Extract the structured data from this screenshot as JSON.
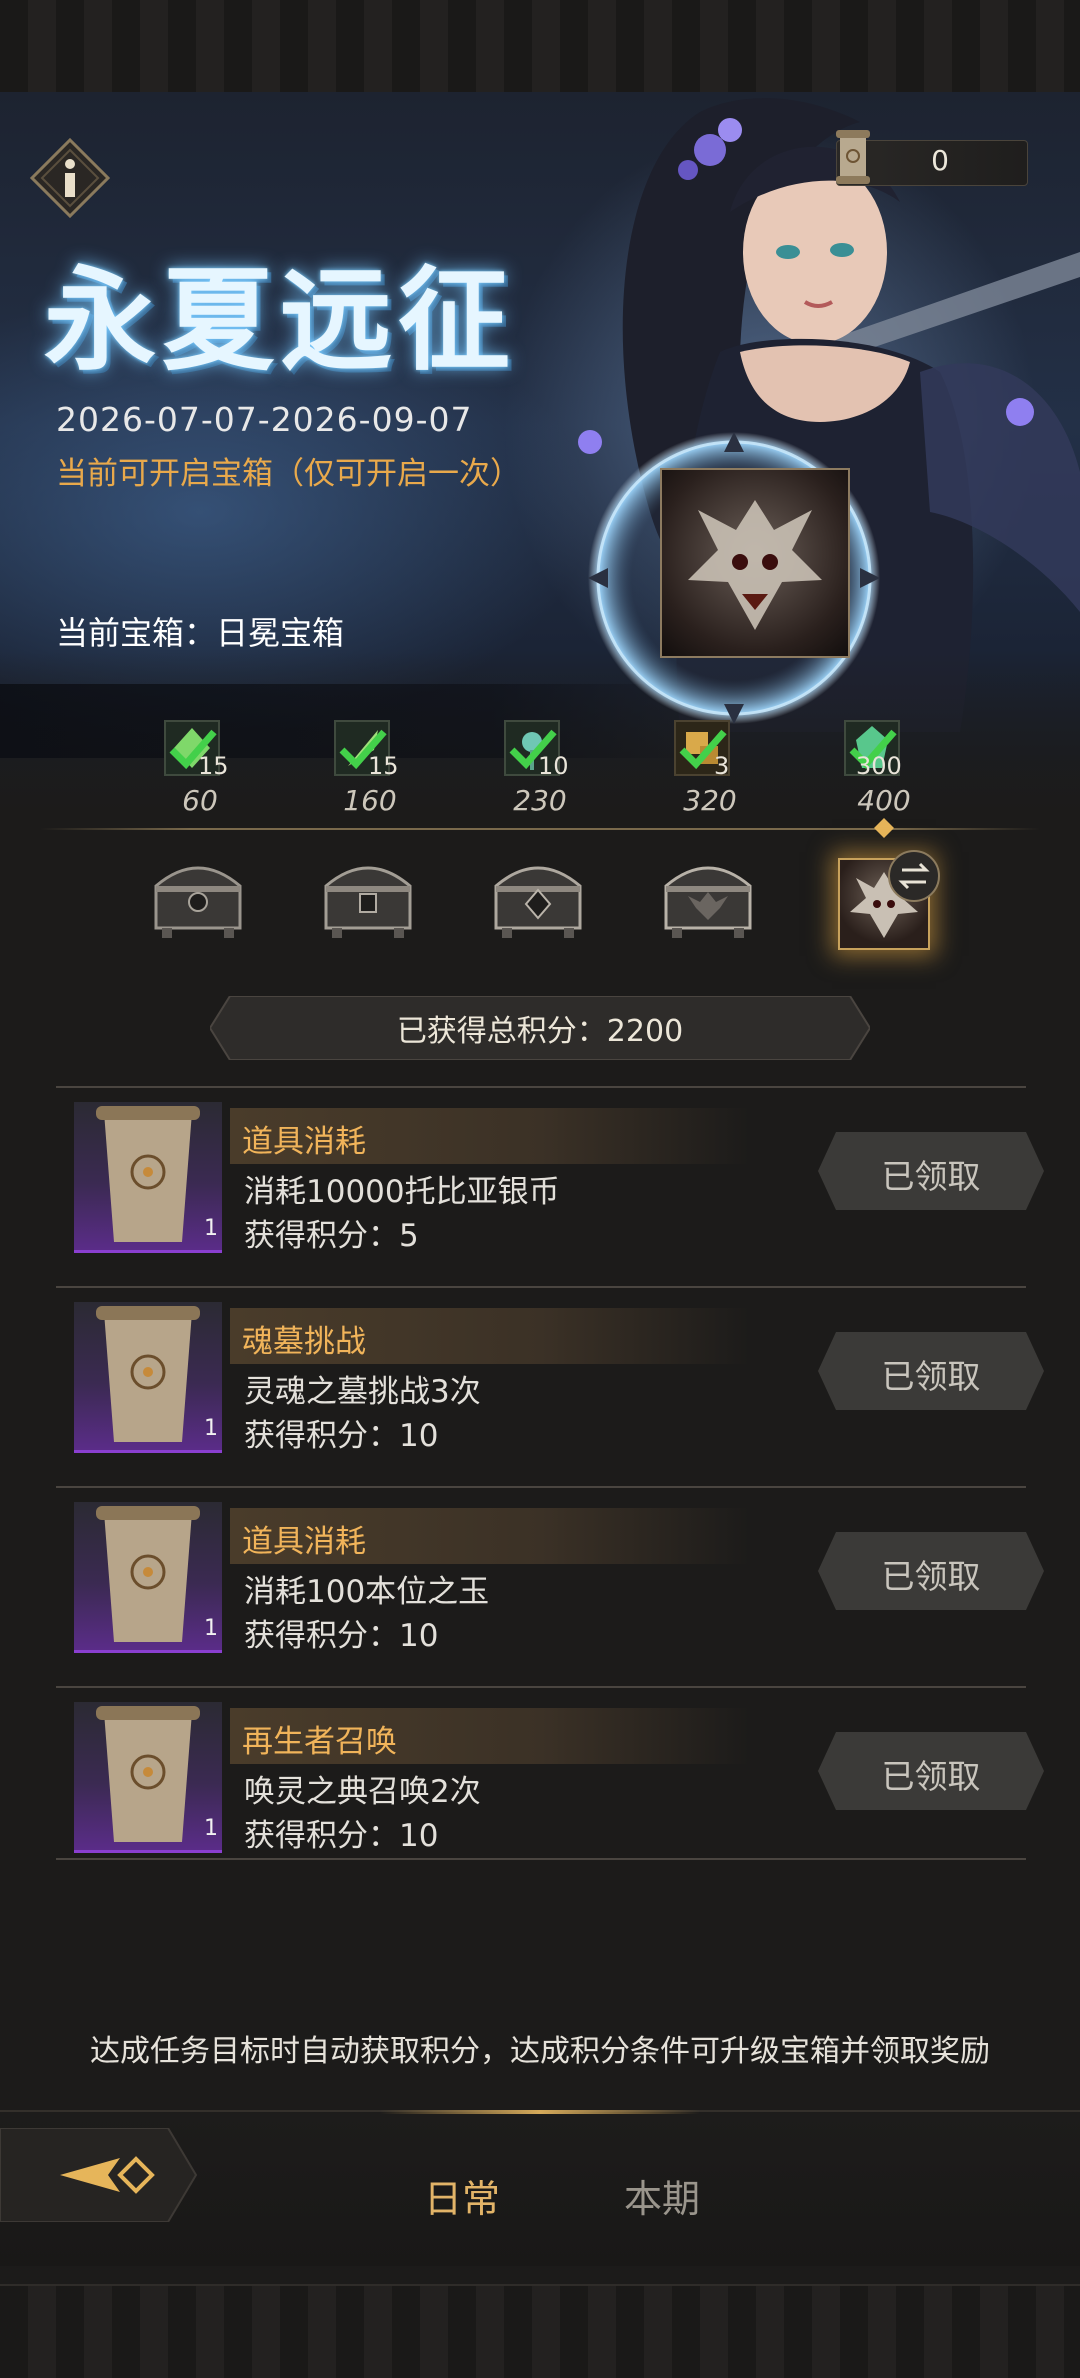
{
  "event": {
    "title": "永夏远征",
    "dates": "2026-07-07-2026-09-07",
    "notice": "当前可开启宝箱（仅可开启一次）",
    "current_chest_label": "当前宝箱：日冕宝箱"
  },
  "currency": {
    "icon": "scroll-icon",
    "value": "0"
  },
  "milestones": [
    {
      "icon": "green-gem-icon",
      "count": "15",
      "score": "60",
      "completed": true
    },
    {
      "icon": "green-feather-icon",
      "count": "15",
      "score": "160",
      "completed": true
    },
    {
      "icon": "green-flower-icon",
      "count": "10",
      "score": "230",
      "completed": true
    },
    {
      "icon": "gold-puzzle-icon",
      "count": "3",
      "score": "320",
      "completed": true
    },
    {
      "icon": "green-crystal-icon",
      "count": "300",
      "score": "400",
      "completed": true
    }
  ],
  "total": {
    "label": "已获得总积分：2200"
  },
  "tasks": [
    {
      "title": "道具消耗",
      "desc": "消耗10000托比亚银币",
      "points": "获得积分：5",
      "qty": "1",
      "button": "已领取",
      "icon": "scroll-icon"
    },
    {
      "title": "魂墓挑战",
      "desc": "灵魂之墓挑战3次",
      "points": "获得积分：10",
      "qty": "1",
      "button": "已领取",
      "icon": "scroll-icon"
    },
    {
      "title": "道具消耗",
      "desc": "消耗100本位之玉",
      "points": "获得积分：10",
      "qty": "1",
      "button": "已领取",
      "icon": "scroll-icon"
    },
    {
      "title": "再生者召唤",
      "desc": "唤灵之典召唤2次",
      "points": "获得积分：10",
      "qty": "1",
      "button": "已领取",
      "icon": "scroll-icon"
    }
  ],
  "footer_hint": "达成任务目标时自动获取积分，达成积分条件可升级宝箱并领取奖励",
  "tabs": [
    {
      "label": "日常",
      "active": true
    },
    {
      "label": "本期",
      "active": false
    }
  ],
  "colors": {
    "accent_gold": "#f1b45a",
    "title_glow": "#7fd3ff",
    "active_tab": "#e2b468",
    "inactive_tab": "#9a958c"
  }
}
